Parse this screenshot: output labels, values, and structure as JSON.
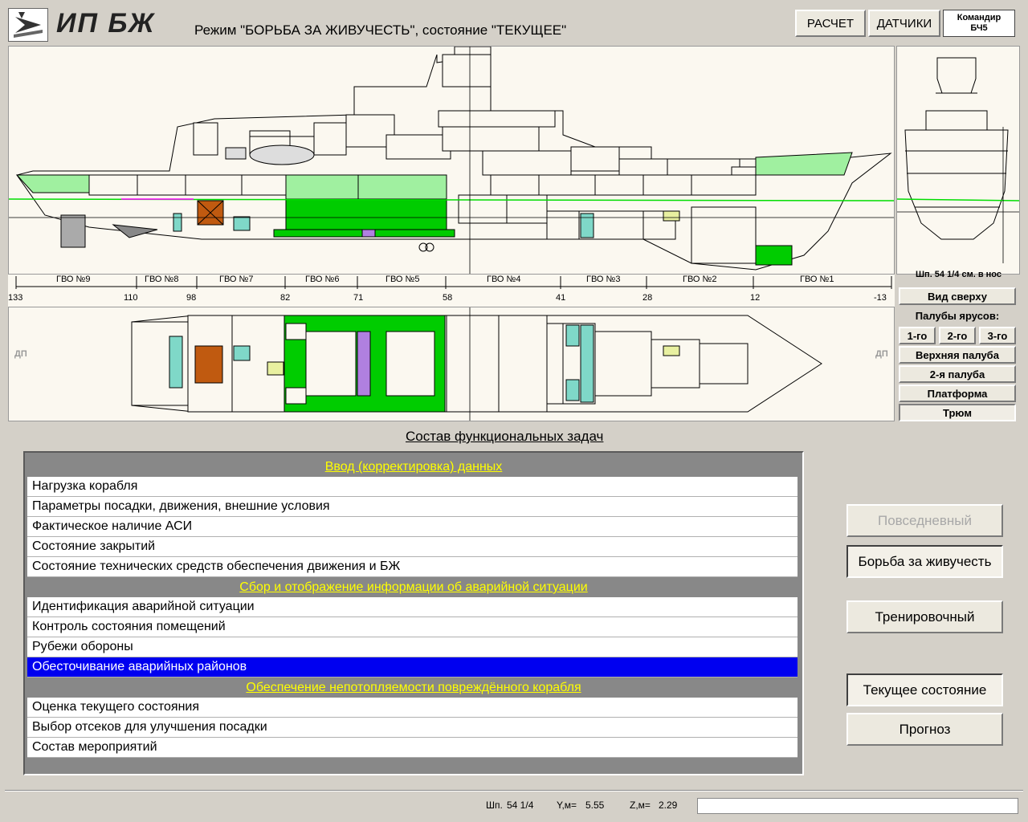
{
  "header": {
    "logo_text": "ИП БЖ",
    "mode_text": "Режим \"БОРЬБА ЗА ЖИВУЧЕСТЬ\", состояние \"ТЕКУЩЕЕ\"",
    "raschet_label": "РАСЧЕТ",
    "datchiki_label": "ДАТЧИКИ",
    "commander_line1": "Командир",
    "commander_line2": "БЧ5"
  },
  "section_view": {
    "caption": "Шп. 54 1/4 см. в нос"
  },
  "scale": {
    "gvo_labels": [
      "ГВО №9",
      "ГВО №8",
      "ГВО №7",
      "ГВО №6",
      "ГВО №5",
      "ГВО №4",
      "ГВО №3",
      "ГВО №2",
      "ГВО №1"
    ],
    "frame_ticks": [
      "133",
      "110",
      "98",
      "82",
      "71",
      "58",
      "41",
      "28",
      "12",
      "-13"
    ]
  },
  "plan_view": {
    "dp_left": "ДП",
    "dp_right": "ДП"
  },
  "side_panel": {
    "top_view": "Вид сверху",
    "deck_tiers": "Палубы ярусов:",
    "tier1": "1-го",
    "tier2": "2-го",
    "tier3": "3-го",
    "upper_deck": "Верхняя палуба",
    "second_deck": "2-я палуба",
    "platform": "Платформа",
    "hold": "Трюм"
  },
  "tasks": {
    "title": "Состав функциональных задач",
    "groups": [
      {
        "header": " Ввод (корректировка) данных",
        "items": [
          "Нагрузка корабля",
          "Параметры посадки, движения, внешние условия",
          "Фактическое наличие АСИ",
          "Состояние закрытий",
          "Состояние технических средств обеспечения движения и БЖ"
        ]
      },
      {
        "header": " Сбор и отображение информации об аварийной ситуации",
        "items": [
          "Идентификация аварийной ситуации",
          "Контроль состояния помещений",
          "Рубежи обороны",
          "Обесточивание аварийных районов"
        ]
      },
      {
        "header": " Обеспечение непотопляемости повреждённого корабля",
        "items": [
          "Оценка текущего состояния",
          "Выбор отсеков для улучшения посадки",
          "Состав мероприятий"
        ]
      }
    ],
    "selected": "Обесточивание аварийных районов"
  },
  "modes": {
    "daily": "Повседневный",
    "damage_control": "Борьба за живучесть",
    "training": "Тренировочный",
    "current_state": "Текущее состояние",
    "forecast": "Прогноз"
  },
  "status": {
    "frame_label": "Шп.",
    "frame_value": "54 1/4",
    "y_label": "Y,м=",
    "y_value": "5.55",
    "z_label": "Z,м=",
    "z_value": "2.29"
  },
  "colors": {
    "green": "#00cc00",
    "light_green": "#a0f0a0",
    "cyan": "#7fd8c8",
    "brown": "#c05a10",
    "purple": "#b080e0",
    "selection": "#0000f0",
    "group_header": "#ffff00"
  }
}
